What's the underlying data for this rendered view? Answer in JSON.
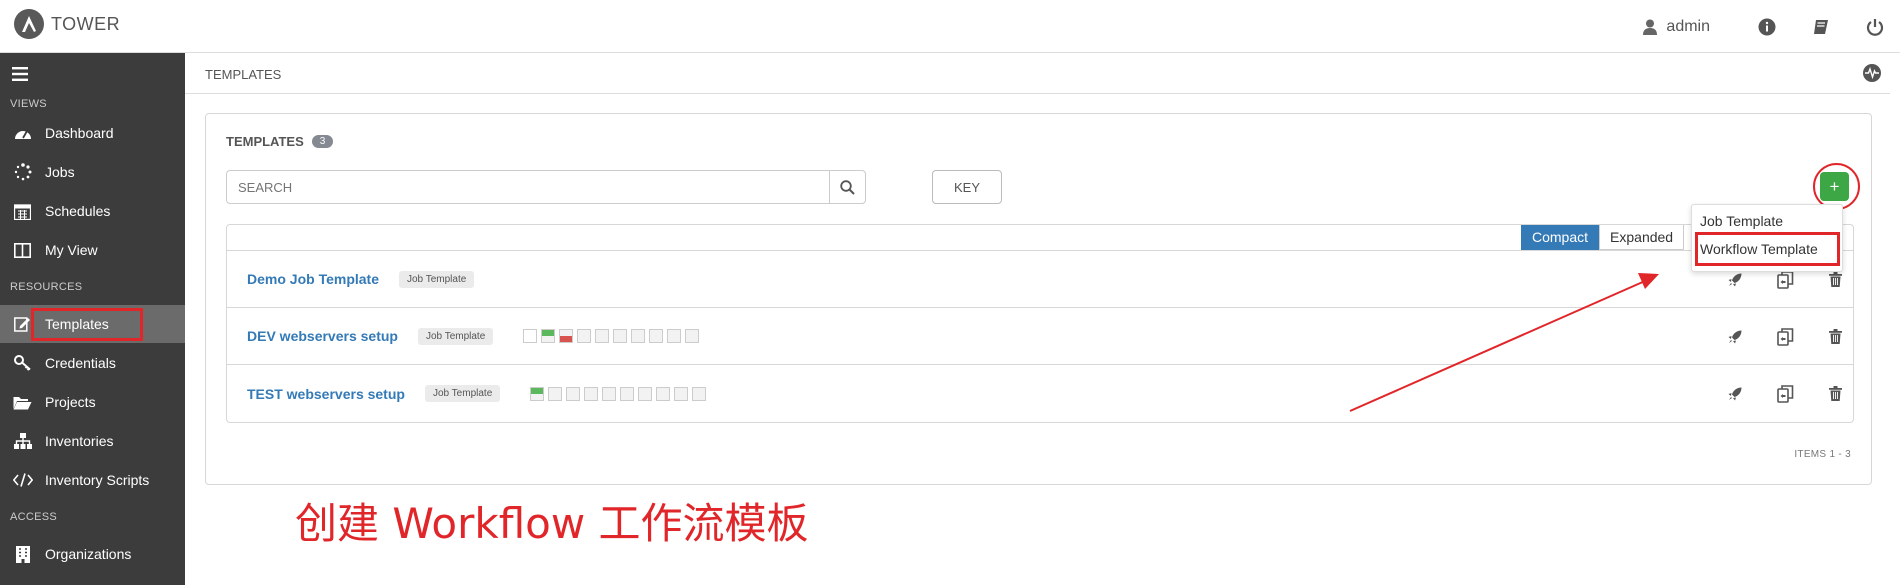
{
  "app": {
    "name": "TOWER",
    "logo_icon": "ansible-a-icon"
  },
  "topbar": {
    "user": "admin",
    "icons": [
      "user-icon",
      "info-icon",
      "book-icon",
      "power-icon"
    ]
  },
  "sidebar": {
    "sections": {
      "views": "VIEWS",
      "resources": "RESOURCES",
      "access": "ACCESS"
    },
    "views": [
      {
        "label": "Dashboard",
        "icon": "dashboard-icon"
      },
      {
        "label": "Jobs",
        "icon": "spinner-icon"
      },
      {
        "label": "Schedules",
        "icon": "calendar-icon"
      },
      {
        "label": "My View",
        "icon": "columns-icon"
      }
    ],
    "resources": [
      {
        "label": "Templates",
        "icon": "edit-icon",
        "active": true
      },
      {
        "label": "Credentials",
        "icon": "key-icon"
      },
      {
        "label": "Projects",
        "icon": "folder-icon"
      },
      {
        "label": "Inventories",
        "icon": "sitemap-icon"
      },
      {
        "label": "Inventory Scripts",
        "icon": "code-icon"
      }
    ],
    "access": [
      {
        "label": "Organizations",
        "icon": "building-icon"
      }
    ]
  },
  "breadcrumb": {
    "label": "TEMPLATES"
  },
  "panel": {
    "title": "TEMPLATES",
    "count": "3",
    "search_placeholder": "SEARCH",
    "key_label": "KEY",
    "add_label": "+",
    "view_toggle": {
      "compact": "Compact",
      "expanded": "Expanded",
      "active": "Compact"
    },
    "rows": [
      {
        "name": "Demo Job Template",
        "type": "Job Template",
        "sparkline": []
      },
      {
        "name": "DEV webservers setup",
        "type": "Job Template",
        "sparkline": [
          "empty",
          "ok",
          "fail",
          "empty",
          "empty",
          "empty",
          "empty",
          "empty",
          "empty",
          "empty"
        ]
      },
      {
        "name": "TEST webservers setup",
        "type": "Job Template",
        "sparkline": [
          "ok",
          "empty",
          "empty",
          "empty",
          "empty",
          "empty",
          "empty",
          "empty",
          "empty",
          "empty"
        ]
      }
    ],
    "items_label": "ITEMS  1 - 3"
  },
  "dropdown": {
    "items": [
      "Job Template",
      "Workflow Template"
    ]
  },
  "annotation": "创建 Workflow 工作流模板",
  "colors": {
    "accent_blue": "#337ab7",
    "add_green": "#3ea745",
    "annotation_red": "#e1262a",
    "sidebar_bg": "#3c3c3c"
  }
}
